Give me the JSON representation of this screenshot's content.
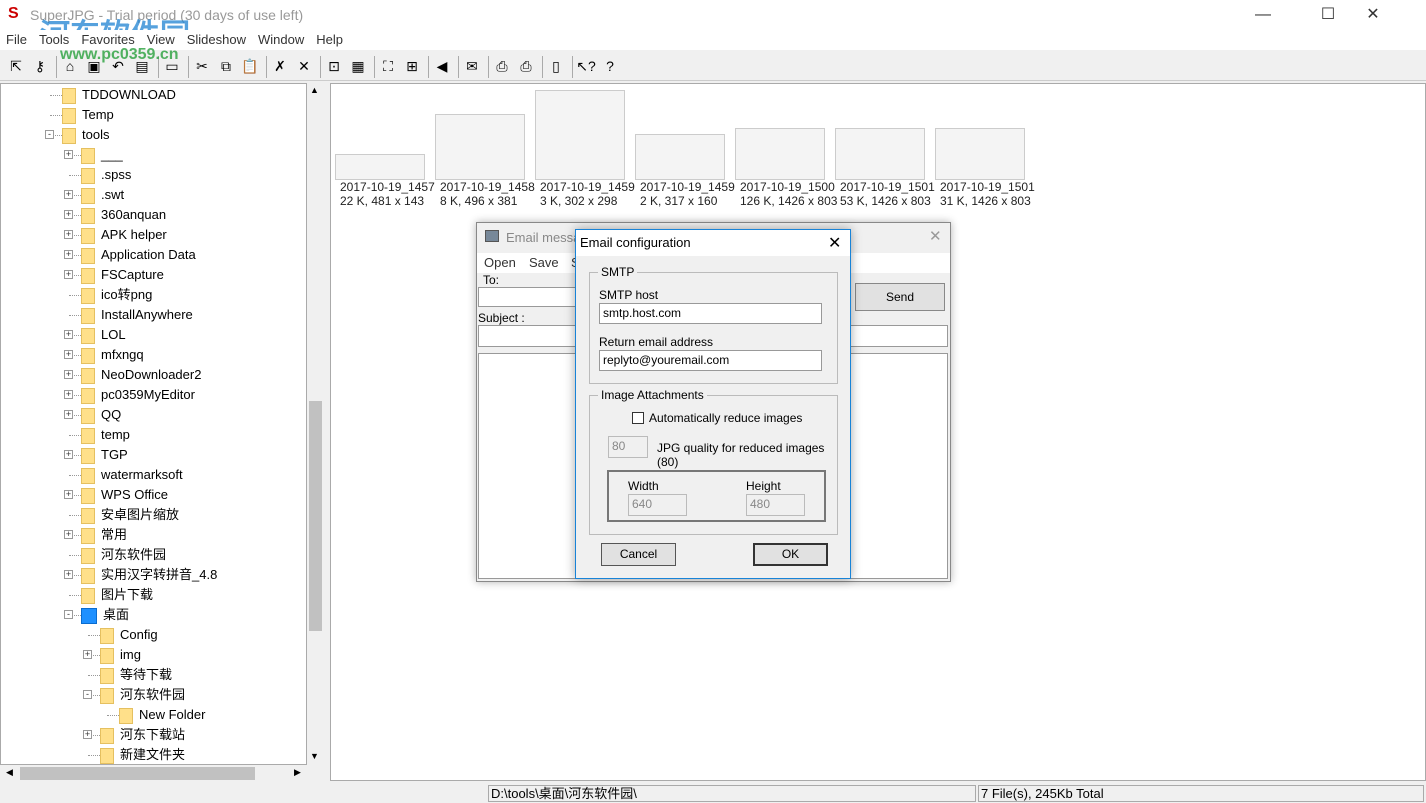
{
  "window": {
    "title": "SuperJPG - Trial period (30 days of use left)",
    "minimize": "—",
    "maximize": "☐",
    "close": "✕"
  },
  "watermark": {
    "text": "河东软件园",
    "url": "www.pc0359.cn"
  },
  "menu": [
    "File",
    "Tools",
    "Favorites",
    "View",
    "Slideshow",
    "Window",
    "Help"
  ],
  "toolbar": [
    {
      "icon": "select-icon",
      "g": "⇱"
    },
    {
      "icon": "key-icon",
      "g": "⚷"
    },
    {
      "sep": true
    },
    {
      "icon": "home-icon",
      "g": "⌂"
    },
    {
      "icon": "save-icon",
      "g": "▣"
    },
    {
      "icon": "undo-icon",
      "g": "↶"
    },
    {
      "icon": "paste-special-icon",
      "g": "▤"
    },
    {
      "sep": true
    },
    {
      "icon": "folder-icon",
      "g": "▭"
    },
    {
      "sep": true
    },
    {
      "icon": "cut-icon",
      "g": "✂"
    },
    {
      "icon": "copy-icon",
      "g": "⧉"
    },
    {
      "icon": "paste-icon",
      "g": "📋"
    },
    {
      "sep": true
    },
    {
      "icon": "delete-icon",
      "g": "✗"
    },
    {
      "icon": "close-icon",
      "g": "✕"
    },
    {
      "sep": true
    },
    {
      "icon": "thumbnails-icon",
      "g": "⊡"
    },
    {
      "icon": "grid-icon",
      "g": "▦"
    },
    {
      "sep": true
    },
    {
      "icon": "fullscreen-icon",
      "g": "⛶"
    },
    {
      "icon": "fit-icon",
      "g": "⊞"
    },
    {
      "sep": true
    },
    {
      "icon": "slideshow-icon",
      "g": "◀"
    },
    {
      "sep": true
    },
    {
      "icon": "email-icon",
      "g": "✉"
    },
    {
      "sep": true
    },
    {
      "icon": "print-icon",
      "g": "⎙"
    },
    {
      "icon": "print-preview-icon",
      "g": "⎙"
    },
    {
      "sep": true
    },
    {
      "icon": "exit-icon",
      "g": "▯"
    },
    {
      "sep": true
    },
    {
      "icon": "context-help-icon",
      "g": "↖?"
    },
    {
      "icon": "help-icon",
      "g": "?"
    }
  ],
  "tree": [
    {
      "label": "TDDOWNLOAD",
      "level": 1,
      "exp": ""
    },
    {
      "label": "Temp",
      "level": 1,
      "exp": ""
    },
    {
      "label": "tools",
      "level": 1,
      "exp": "-"
    },
    {
      "label": "___",
      "level": 2,
      "exp": "+"
    },
    {
      "label": ".spss",
      "level": 2,
      "exp": ""
    },
    {
      "label": ".swt",
      "level": 2,
      "exp": "+"
    },
    {
      "label": "360anquan",
      "level": 2,
      "exp": "+"
    },
    {
      "label": "APK helper",
      "level": 2,
      "exp": "+"
    },
    {
      "label": "Application Data",
      "level": 2,
      "exp": "+"
    },
    {
      "label": "FSCapture",
      "level": 2,
      "exp": "+"
    },
    {
      "label": "ico转png",
      "level": 2,
      "exp": ""
    },
    {
      "label": "InstallAnywhere",
      "level": 2,
      "exp": ""
    },
    {
      "label": "LOL",
      "level": 2,
      "exp": "+"
    },
    {
      "label": "mfxngq",
      "level": 2,
      "exp": "+"
    },
    {
      "label": "NeoDownloader2",
      "level": 2,
      "exp": "+"
    },
    {
      "label": "pc0359MyEditor",
      "level": 2,
      "exp": "+"
    },
    {
      "label": "QQ",
      "level": 2,
      "exp": "+"
    },
    {
      "label": "temp",
      "level": 2,
      "exp": ""
    },
    {
      "label": "TGP",
      "level": 2,
      "exp": "+"
    },
    {
      "label": "watermarksoft",
      "level": 2,
      "exp": ""
    },
    {
      "label": "WPS Office",
      "level": 2,
      "exp": "+"
    },
    {
      "label": "安卓图片缩放",
      "level": 2,
      "exp": ""
    },
    {
      "label": "常用",
      "level": 2,
      "exp": "+"
    },
    {
      "label": "河东软件园",
      "level": 2,
      "exp": ""
    },
    {
      "label": "实用汉字转拼音_4.8",
      "level": 2,
      "exp": "+"
    },
    {
      "label": "图片下载",
      "level": 2,
      "exp": ""
    },
    {
      "label": "桌面",
      "level": 2,
      "exp": "-",
      "blue": true
    },
    {
      "label": "Config",
      "level": 3,
      "exp": ""
    },
    {
      "label": "img",
      "level": 3,
      "exp": "+"
    },
    {
      "label": "等待下载",
      "level": 3,
      "exp": ""
    },
    {
      "label": "河东软件园",
      "level": 3,
      "exp": "-"
    },
    {
      "label": "New Folder",
      "level": 4,
      "exp": ""
    },
    {
      "label": "河东下载站",
      "level": 3,
      "exp": "+"
    },
    {
      "label": "新建文件夹",
      "level": 3,
      "exp": ""
    }
  ],
  "thumbnails": [
    {
      "name": "2017-10-19_1457",
      "info": "22 K, 481 x 143"
    },
    {
      "name": "2017-10-19_1458",
      "info": "8 K, 496 x 381"
    },
    {
      "name": "2017-10-19_1459",
      "info": "3 K, 302 x 298"
    },
    {
      "name": "2017-10-19_1459",
      "info": "2 K, 317 x 160"
    },
    {
      "name": "2017-10-19_1500",
      "info": "126 K, 1426 x 803"
    },
    {
      "name": "2017-10-19_1501",
      "info": "53 K, 1426 x 803"
    },
    {
      "name": "2017-10-19_1501",
      "info": "31 K, 1426 x 803"
    }
  ],
  "status": {
    "path": "D:\\tools\\桌面\\河东软件园\\",
    "summary": "7 File(s), 245Kb Total"
  },
  "email": {
    "title": "Email message",
    "menu": [
      "Open",
      "Save",
      "S"
    ],
    "to_label": "To:",
    "subject_label": "Subject :",
    "send": "Send",
    "close": "✕"
  },
  "config": {
    "title": "Email configuration",
    "close": "✕",
    "smtp_group": "SMTP",
    "smtp_host_label": "SMTP host",
    "smtp_host": "smtp.host.com",
    "return_label": "Return email address",
    "return_email": "replyto@youremail.com",
    "attach_group": "Image Attachments",
    "auto_reduce_label": "Automatically reduce images",
    "auto_reduce": false,
    "quality": "80",
    "quality_label": "JPG quality for reduced images (80)",
    "width_label": "Width",
    "width": "640",
    "height_label": "Height",
    "height": "480",
    "cancel": "Cancel",
    "ok": "OK"
  }
}
